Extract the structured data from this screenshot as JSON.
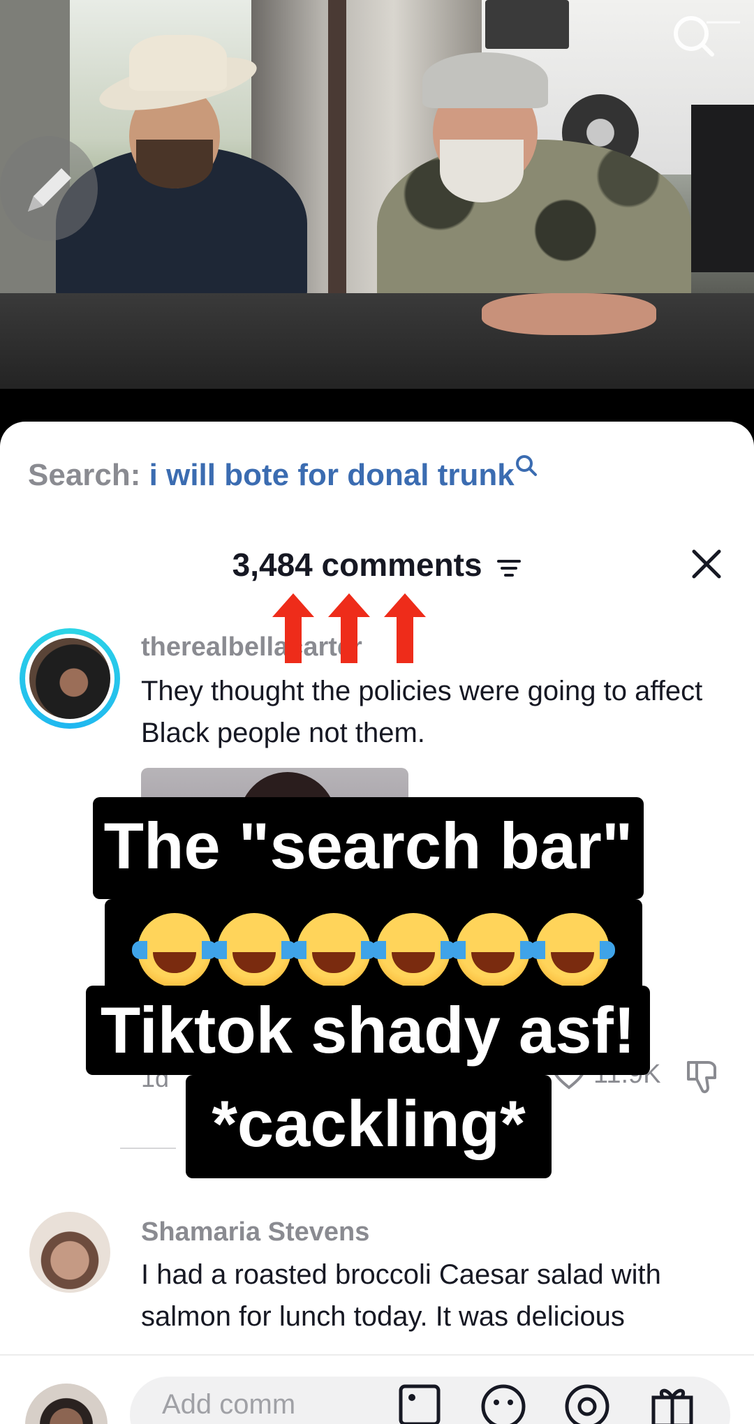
{
  "search": {
    "prefix": "Search:",
    "term": "i will bote for donal trunk"
  },
  "comments_header": {
    "count_label": "3,484 comments"
  },
  "comments": [
    {
      "username": "therealbellacarter",
      "text": "They thought the policies were going to affect Black people not them.",
      "time": "1d",
      "likes": "11.9K"
    },
    {
      "username": "Shamaria Stevens",
      "text": "I had a roasted broccoli Caesar salad with salmon for lunch today. It was delicious"
    }
  ],
  "caption": {
    "line1": "The \"search bar\"",
    "line3": "Tiktok shady asf!",
    "line4": "*cackling*"
  },
  "input": {
    "placeholder": "Add comm"
  },
  "colors": {
    "search_term": "#3b6cb1",
    "arrow_red": "#ee2c1a",
    "ring": "#2dd5e6"
  },
  "icons": [
    "search-icon",
    "pencil-icon",
    "filter-icon",
    "close-icon",
    "heart-icon",
    "dislike-icon",
    "image-icon",
    "emoji-icon",
    "at-icon",
    "gift-icon"
  ]
}
